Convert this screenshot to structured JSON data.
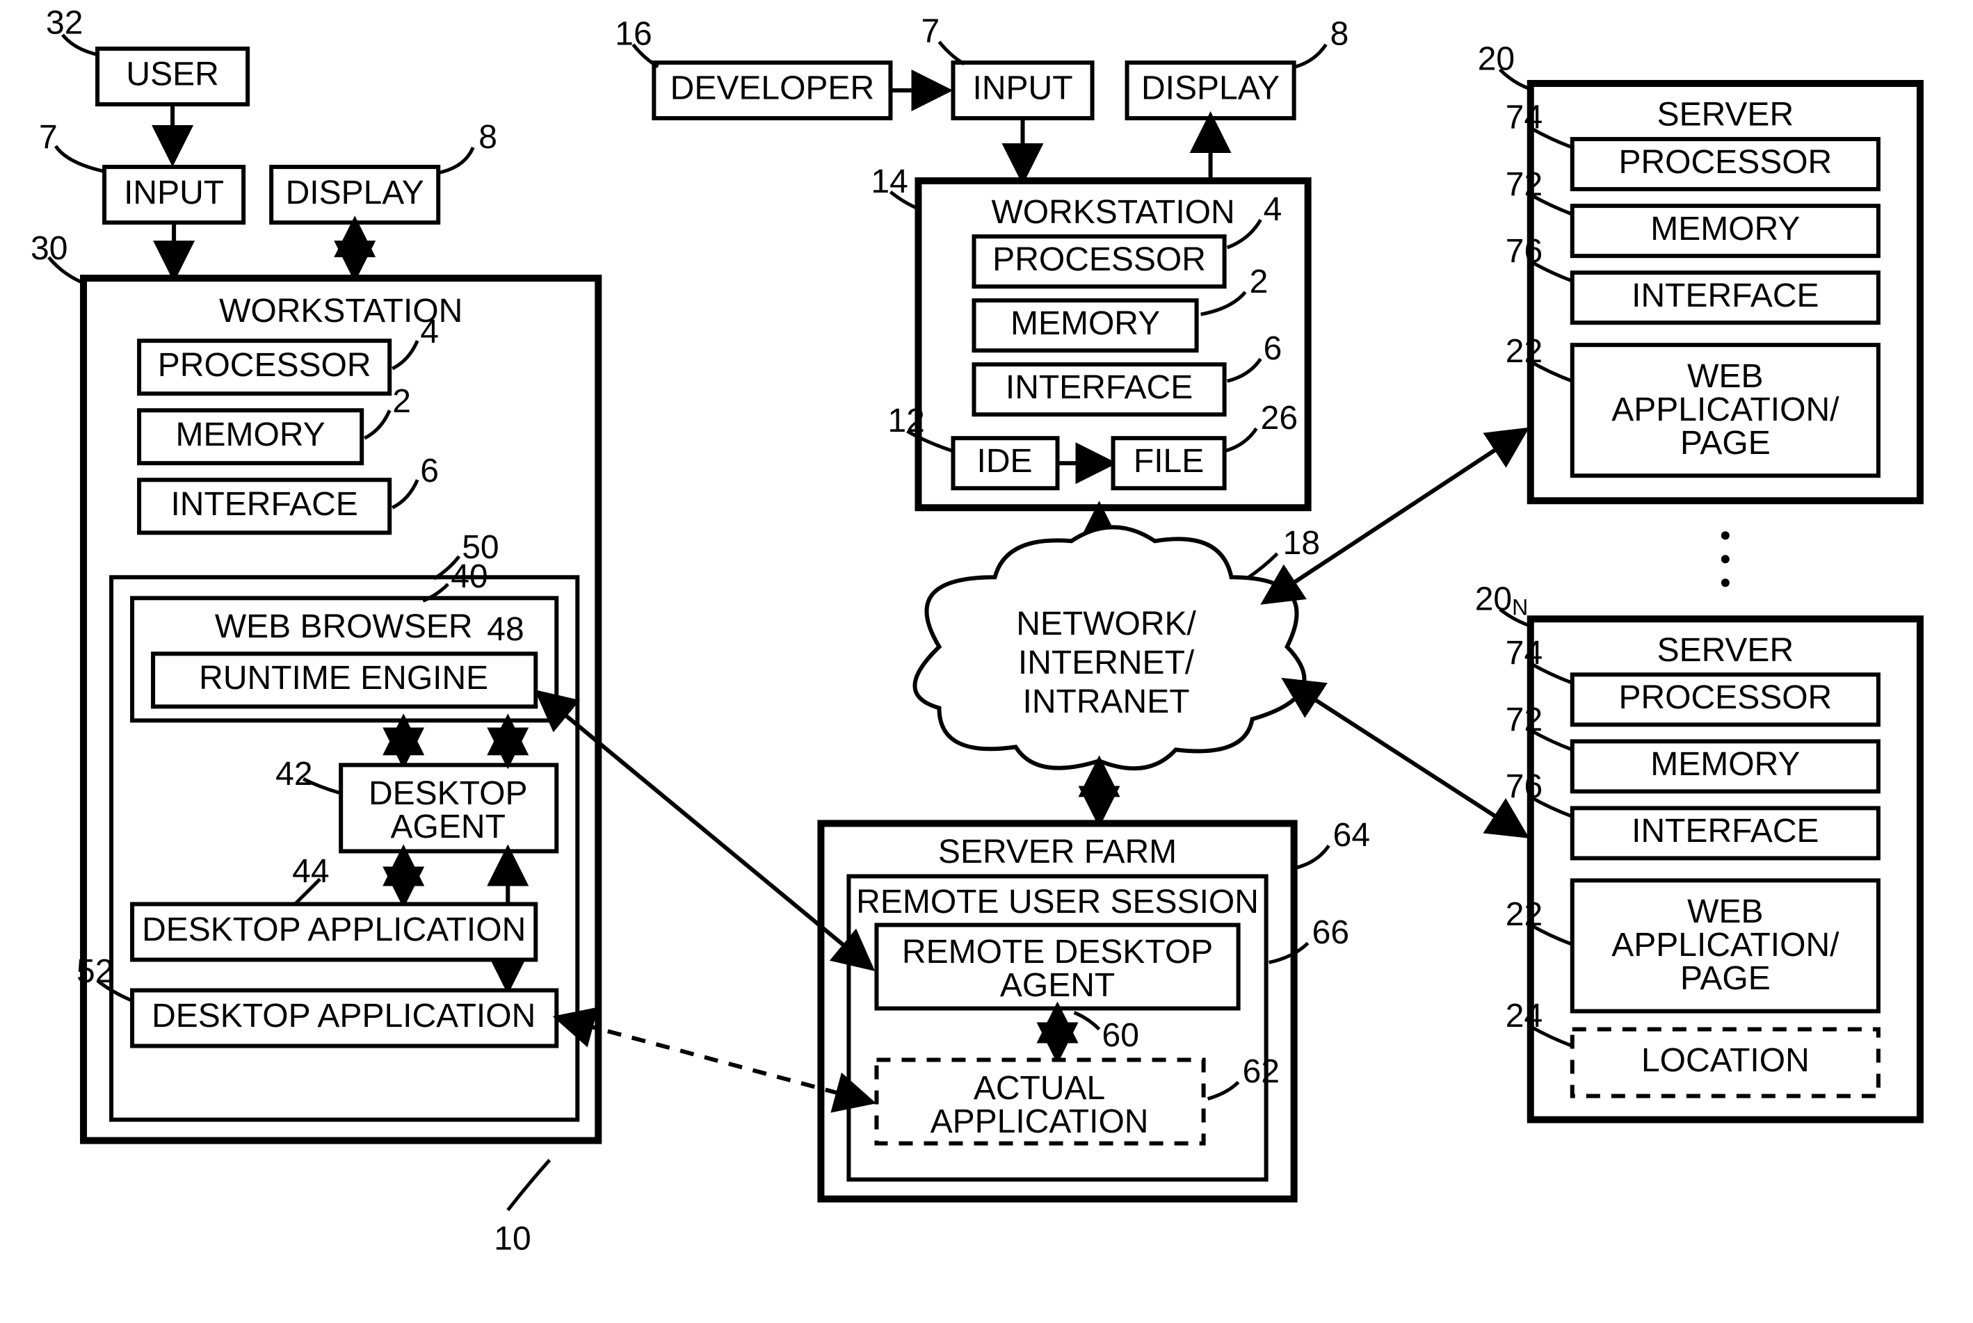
{
  "figure_label": "10",
  "refs": {
    "r32": "32",
    "r7a": "7",
    "r8a": "8",
    "r16": "16",
    "r7b": "7",
    "r8b": "8",
    "r30": "30",
    "r4a": "4",
    "r2a": "2",
    "r6a": "6",
    "r14": "14",
    "r4b": "4",
    "r2b": "2",
    "r6b": "6",
    "r12": "12",
    "r26": "26",
    "r50": "50",
    "r40": "40",
    "r48": "48",
    "r42": "42",
    "r44": "44",
    "r52": "52",
    "r18": "18",
    "r64": "64",
    "r66": "66",
    "r60": "60",
    "r62": "62",
    "r20": "20",
    "r74a": "74",
    "r72a": "72",
    "r76a": "76",
    "r22a": "22",
    "r20n": "20",
    "r20n_sub": "N",
    "r74b": "74",
    "r72b": "72",
    "r76b": "76",
    "r22b": "22",
    "r24": "24"
  },
  "labels": {
    "user": "USER",
    "input": "INPUT",
    "display": "DISPLAY",
    "developer": "DEVELOPER",
    "workstation": "WORKSTATION",
    "processor": "PROCESSOR",
    "memory": "MEMORY",
    "interface": "INTERFACE",
    "ide": "IDE",
    "file": "FILE",
    "web_browser": "WEB BROWSER",
    "runtime_engine": "RUNTIME ENGINE",
    "desktop_agent_l1": "DESKTOP",
    "desktop_agent_l2": "AGENT",
    "desktop_application": "DESKTOP APPLICATION",
    "server_farm": "SERVER FARM",
    "remote_user_session": "REMOTE USER SESSION",
    "remote_desktop_l1": "REMOTE DESKTOP",
    "remote_desktop_l2": "AGENT",
    "actual_l1": "ACTUAL",
    "actual_l2": "APPLICATION",
    "network_l1": "NETWORK/",
    "network_l2": "INTERNET/",
    "network_l3": "INTRANET",
    "server": "SERVER",
    "web_app_l1": "WEB",
    "web_app_l2": "APPLICATION/",
    "web_app_l3": "PAGE",
    "location": "LOCATION"
  }
}
